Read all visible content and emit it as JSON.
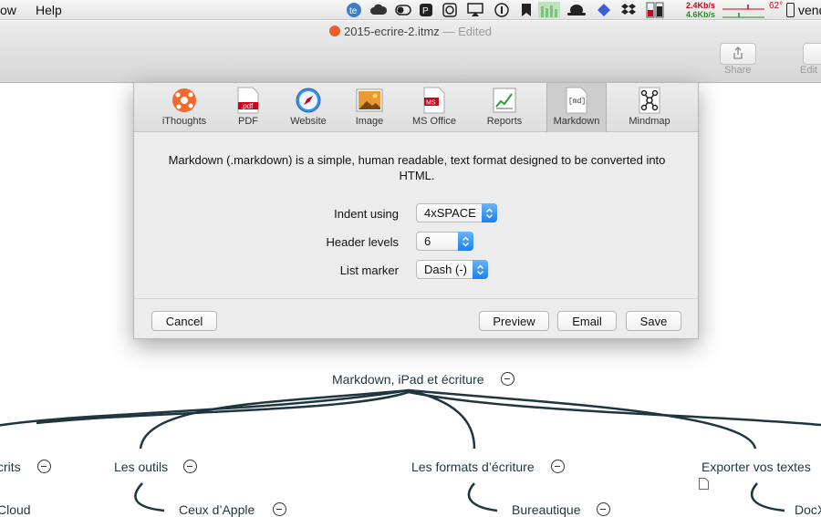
{
  "menubar": {
    "menus": [
      "ow",
      "Help"
    ],
    "net_up": "2.4Kb/s",
    "net_down": "4.6Kb/s",
    "temperature": "62°",
    "clock": "vend",
    "tray_icons": [
      "textexpander-icon",
      "cloud-icon",
      "toggle-icon",
      "pastebot-icon",
      "timer-icon",
      "airplay-icon",
      "info-icon",
      "bookmark-icon",
      "cpu-meter-icon",
      "hat-icon",
      "diamond-icon",
      "dropbox-icon",
      "memory-meter-icon"
    ]
  },
  "window": {
    "doc_title": "2015-ecrire-2.itmz",
    "separator": "—",
    "edited": "Edited",
    "share_label": "Share",
    "edit_label": "Edit"
  },
  "export": {
    "tabs": [
      {
        "label": "iThoughts",
        "icon": "ithoughts-icon"
      },
      {
        "label": "PDF",
        "icon": "pdf-icon"
      },
      {
        "label": "Website",
        "icon": "compass-icon"
      },
      {
        "label": "Image",
        "icon": "image-icon"
      },
      {
        "label": "MS Office",
        "icon": "ms-office-icon"
      },
      {
        "label": "Reports",
        "icon": "chart-icon"
      },
      {
        "label": "Markdown",
        "icon": "markdown-icon"
      },
      {
        "label": "Mindmap",
        "icon": "mindmap-icon"
      }
    ],
    "selected_tab": "Markdown",
    "pdf_badge": ".pdf",
    "ms_badge": "MS",
    "md_badge": "[md]",
    "description": "Markdown (.markdown) is a simple, human readable, text format designed to be converted into HTML.",
    "fields": {
      "indent_label": "Indent using",
      "indent_value": "4xSPACE",
      "header_label": "Header levels",
      "header_value": "6",
      "list_label": "List marker",
      "list_value": "Dash (-)"
    },
    "buttons": {
      "cancel": "Cancel",
      "preview": "Preview",
      "email": "Email",
      "save": "Save"
    }
  },
  "mindmap": {
    "root": "Markdown, iPad et écriture",
    "branches": [
      "crits",
      "Les outils",
      "Les formats d’écriture",
      "Exporter vos textes"
    ],
    "sub_nodes": [
      "Cloud",
      "Ceux d’Apple",
      "Bureautique",
      "DocX"
    ]
  },
  "colors": {
    "accent_blue": "#1a7ff2",
    "mindmap_line": "#1f3540",
    "net_up": "#d0021b",
    "net_down": "#2a8a2a"
  }
}
